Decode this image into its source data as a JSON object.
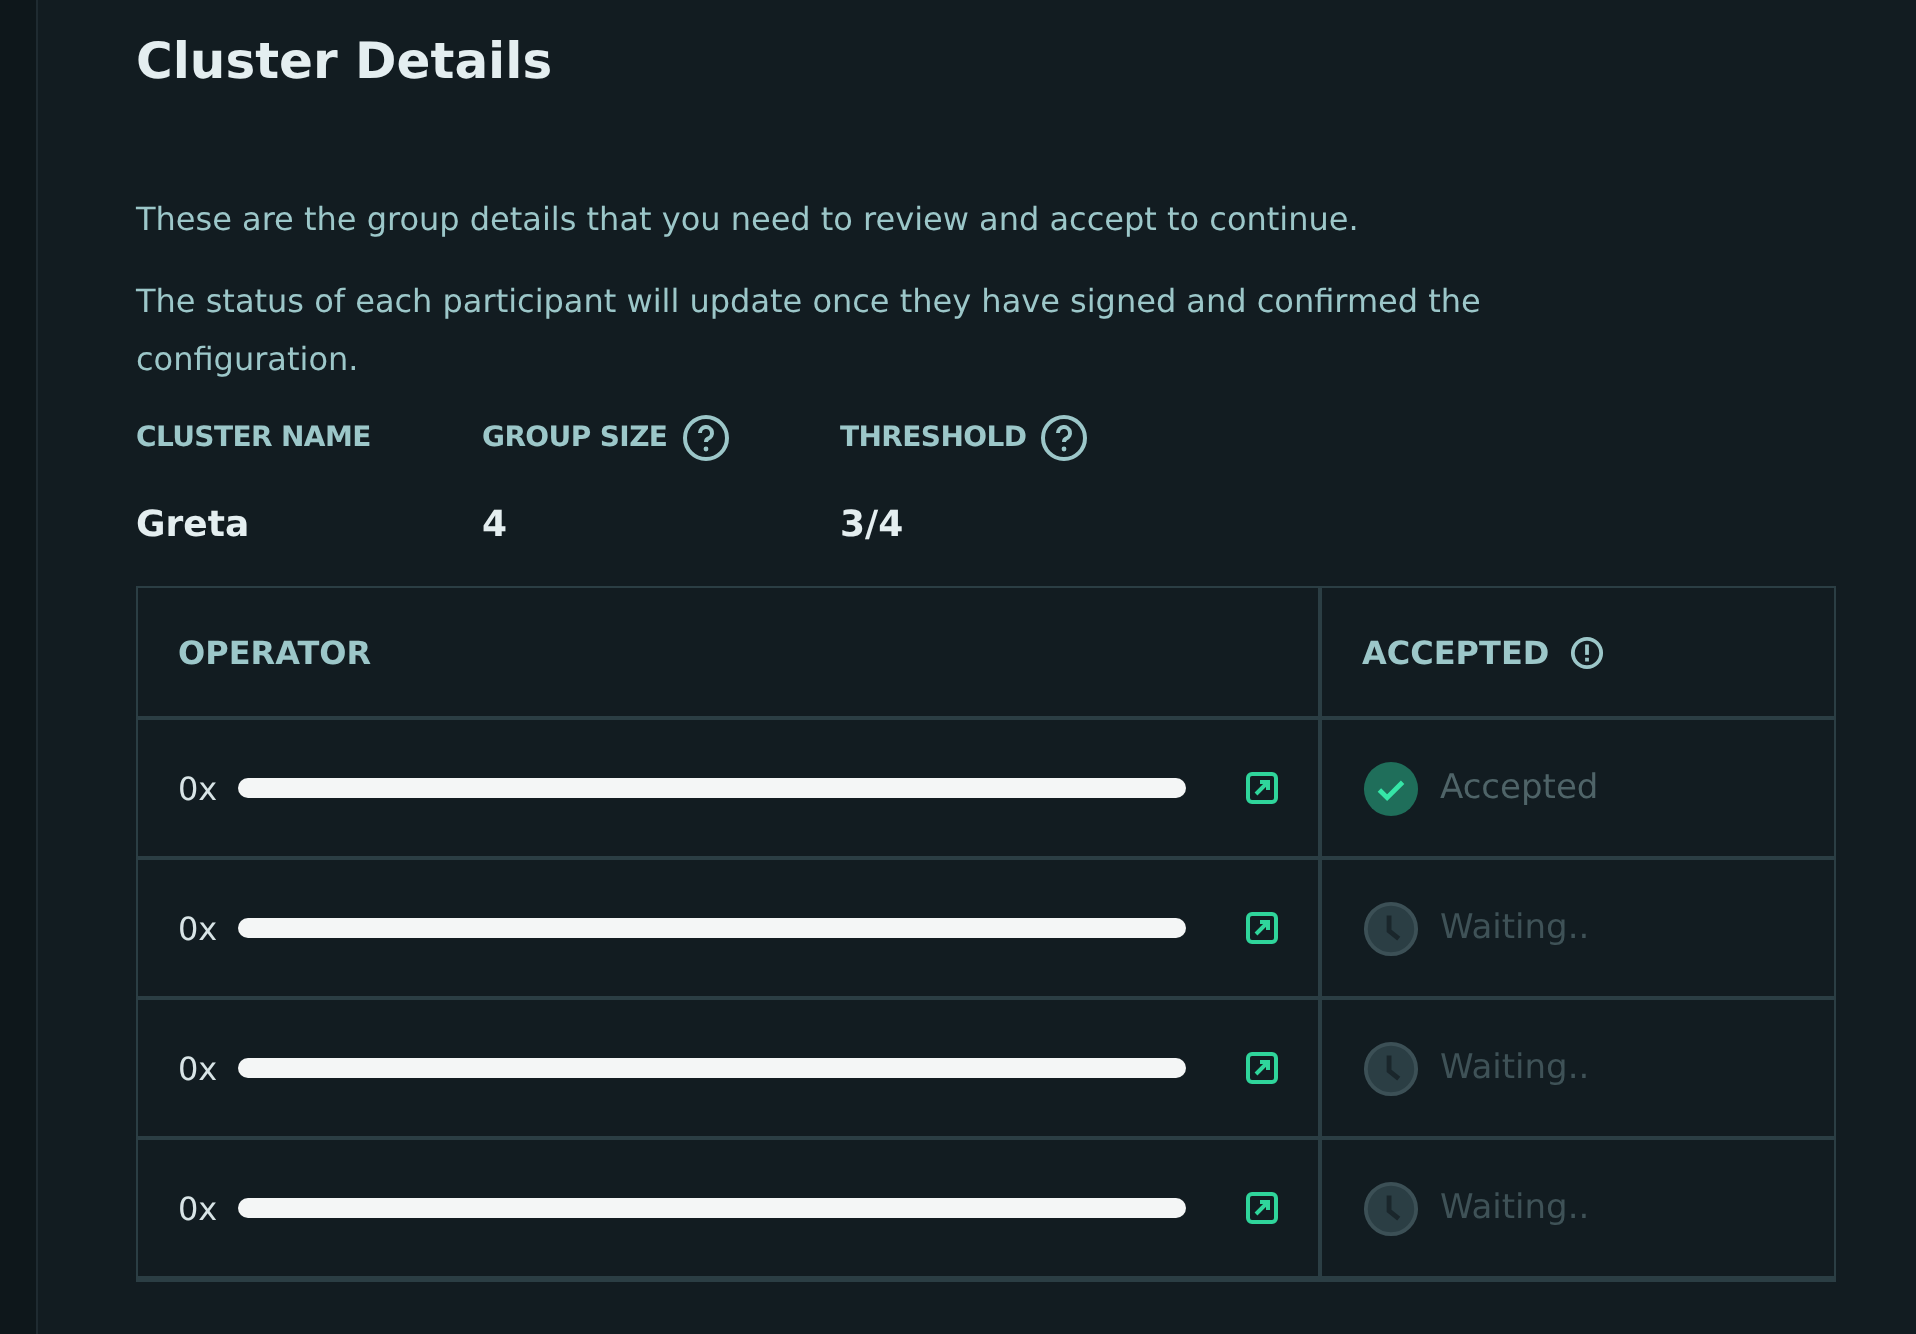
{
  "title": "Cluster Details",
  "paragraphs": [
    "These are the group details that you need to review and accept to continue.",
    "The status of each participant will update once they have signed and confirmed the configuration."
  ],
  "fields": [
    {
      "label": "CLUSTER NAME",
      "help": false,
      "value": "Greta"
    },
    {
      "label": "GROUP SIZE",
      "help": true,
      "value": "4"
    },
    {
      "label": "THRESHOLD",
      "help": true,
      "value": "3/4"
    }
  ],
  "table": {
    "columns": [
      "OPERATOR",
      "ACCEPTED"
    ],
    "rows": [
      {
        "address": "0x",
        "status": "Accepted",
        "accepted": true
      },
      {
        "address": "0x",
        "status": "Waiting..",
        "accepted": false
      },
      {
        "address": "0x",
        "status": "Waiting..",
        "accepted": false
      },
      {
        "address": "0x",
        "status": "Waiting..",
        "accepted": false
      }
    ]
  }
}
